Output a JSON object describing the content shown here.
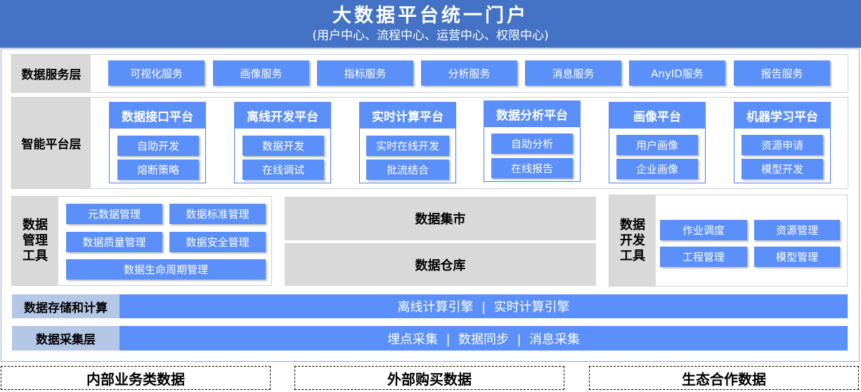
{
  "banner": {
    "title": "大数据平台统一门户",
    "subtitle": "(用户中心、流程中心、运营中心、权限中心)"
  },
  "service_layer": {
    "label": "数据服务层",
    "items": [
      "可视化服务",
      "画像服务",
      "指标服务",
      "分析服务",
      "消息服务",
      "AnyID服务",
      "报告服务"
    ]
  },
  "platform_layer": {
    "label": "智能平台层",
    "platforms": [
      {
        "name": "数据接口平台",
        "items": [
          "自助开发",
          "熔断策略"
        ]
      },
      {
        "name": "离线开发平台",
        "items": [
          "数据开发",
          "在线调试"
        ]
      },
      {
        "name": "实时计算平台",
        "items": [
          "实时在线开发",
          "批流结合"
        ]
      },
      {
        "name": "数据分析平台",
        "items": [
          "自助分析",
          "在线报告"
        ]
      },
      {
        "name": "画像平台",
        "items": [
          "用户画像",
          "企业画像"
        ]
      },
      {
        "name": "机器学习平台",
        "items": [
          "资源申请",
          "模型开发"
        ]
      }
    ]
  },
  "mgmt_tools": {
    "label": "数据\n管理\n工具",
    "items": [
      "元数据管理",
      "数据标准管理",
      "数据质量管理",
      "数据安全管理",
      "数据生命周期管理"
    ]
  },
  "center": {
    "mart": "数据集市",
    "warehouse": "数据仓库"
  },
  "dev_tools": {
    "label": "数据\n开发\n工具",
    "items": [
      "作业调度",
      "资源管理",
      "工程管理",
      "模型管理"
    ]
  },
  "storage_layer": {
    "label": "数据存储和计算",
    "content": "离线计算引擎  |  实时计算引擎"
  },
  "collection_layer": {
    "label": "数据采集层",
    "content": "埋点采集  |  数据同步  |  消息采集"
  },
  "sources": [
    "内部业务类数据",
    "外部购买数据",
    "生态合作数据"
  ],
  "colors": {
    "banner": "#4472c4",
    "button": "#5b8ff9",
    "label_gray": "#d9d9d9",
    "strip_label": "#b4c7e7"
  }
}
